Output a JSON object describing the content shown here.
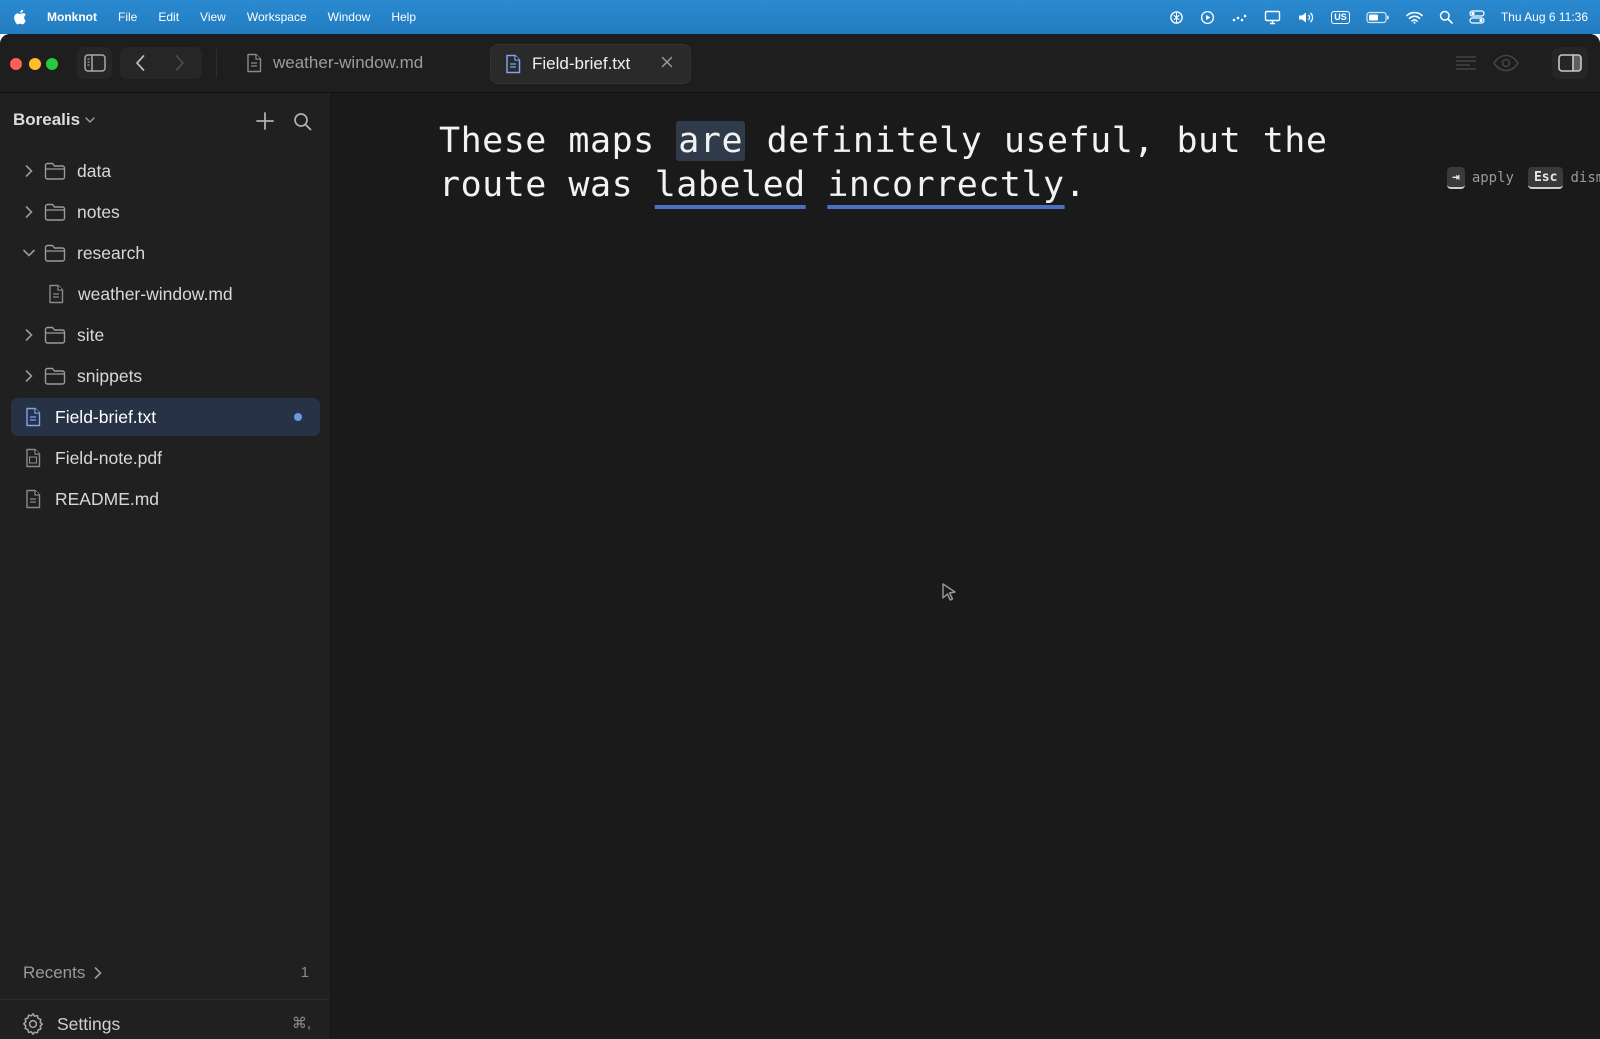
{
  "menubar": {
    "app_name": "Monknot",
    "menus": [
      "File",
      "Edit",
      "View",
      "Workspace",
      "Window",
      "Help"
    ],
    "input_source": "US",
    "clock": "Thu Aug 6  11:36"
  },
  "tabs": [
    {
      "label": "weather-window.md",
      "active": false
    },
    {
      "label": "Field-brief.txt",
      "active": true
    }
  ],
  "sidebar": {
    "vault_name": "Borealis",
    "tree": [
      {
        "label": "data",
        "type": "folder",
        "expanded": false
      },
      {
        "label": "notes",
        "type": "folder",
        "expanded": false
      },
      {
        "label": "research",
        "type": "folder",
        "expanded": true
      },
      {
        "label": "weather-window.md",
        "type": "file",
        "parent": "research"
      },
      {
        "label": "site",
        "type": "folder",
        "expanded": false
      },
      {
        "label": "snippets",
        "type": "folder",
        "expanded": false
      },
      {
        "label": "Field-brief.txt",
        "type": "file",
        "active": true,
        "unsaved": true
      },
      {
        "label": "Field-note.pdf",
        "type": "pdf"
      },
      {
        "label": "README.md",
        "type": "file"
      }
    ],
    "recents_label": "Recents",
    "recents_count": "1",
    "settings_label": "Settings",
    "settings_shortcut": "⌘,"
  },
  "editor": {
    "line1": {
      "before": "These maps ",
      "selected": "are",
      "after": " definitely useful, but the"
    },
    "line2": {
      "before": "route was ",
      "flag1": "labeled",
      "between": " ",
      "flag2": "incorrectly",
      "end": "."
    },
    "suggestion": {
      "tab_key": "⇥",
      "apply_label": "apply",
      "esc_key": "Esc",
      "dismiss_label": "dismiss"
    }
  },
  "colors": {
    "accent": "#4a70c4",
    "selection": "#2f3a4a",
    "active_row": "#283247"
  }
}
